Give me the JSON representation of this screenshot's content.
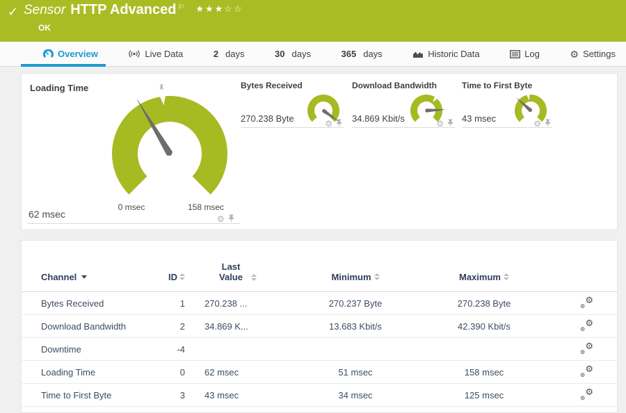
{
  "colors": {
    "brand_green": "#aabc23",
    "gauge_green": "#a6ba22",
    "active_blue": "#1a9ad0",
    "page_bg": "#f0f0f0",
    "table_header": "#2e3e5e",
    "table_text": "#3c4c63",
    "needle_gray": "#6d6d6d"
  },
  "icons": {
    "check": "✓",
    "flag": "⚐",
    "gear": "⚙",
    "avg_marker": "x̄"
  },
  "header": {
    "title_prefix": "Sensor",
    "title": "HTTP Advanced",
    "rating_display": "★★★☆☆",
    "status": "OK"
  },
  "tabs": [
    {
      "label": "Overview",
      "icon": "gauge-icon",
      "active": true
    },
    {
      "label": "Live Data",
      "icon": "live-icon"
    },
    {
      "num": "2",
      "unit": "days"
    },
    {
      "num": "30",
      "unit": "days"
    },
    {
      "num": "365",
      "unit": "days"
    },
    {
      "label": "Historic Data",
      "icon": "area-chart-icon"
    },
    {
      "label": "Log",
      "icon": "log-icon"
    },
    {
      "label": "Settings",
      "icon": "gear-icon"
    }
  ],
  "gauges": {
    "loading_time": {
      "title": "Loading Time",
      "value": "62 msec",
      "scale_min": "0 msec",
      "scale_max": "158 msec",
      "needle_deg": 121,
      "avg_marker_deg": 97,
      "avg_symbol": "x̄"
    },
    "bytes_received": {
      "title": "Bytes Received",
      "value": "270.238 Byte",
      "needle_deg": -36
    },
    "download_bandwidth": {
      "title": "Download Bandwidth",
      "value": "34.869 Kbit/s",
      "needle_deg": 3,
      "avg_marker_deg": 53
    },
    "time_to_first_byte": {
      "title": "Time to First Byte",
      "value": "43 msec",
      "needle_deg": 138,
      "avg_marker_deg": 99
    }
  },
  "table": {
    "header": {
      "channel": "Channel",
      "id": "ID",
      "last_value": "Last Value",
      "minimum": "Minimum",
      "maximum": "Maximum"
    },
    "rows": [
      {
        "channel": "Bytes Received",
        "id": "1",
        "last": "270.238 ...",
        "min": "270.237 Byte",
        "max": "270.238 Byte"
      },
      {
        "channel": "Download Bandwidth",
        "id": "2",
        "last": "34.869 K...",
        "min": "13.683 Kbit/s",
        "max": "42.390 Kbit/s"
      },
      {
        "channel": "Downtime",
        "id": "-4",
        "last": "",
        "min": "",
        "max": ""
      },
      {
        "channel": "Loading Time",
        "id": "0",
        "last": "62 msec",
        "min": "51 msec",
        "max": "158 msec"
      },
      {
        "channel": "Time to First Byte",
        "id": "3",
        "last": "43 msec",
        "min": "34 msec",
        "max": "125 msec"
      }
    ]
  }
}
